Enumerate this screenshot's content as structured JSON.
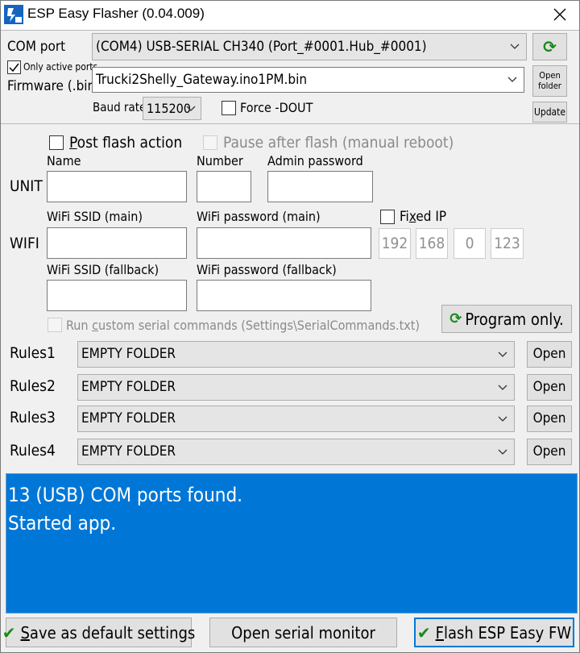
{
  "window": {
    "title": "ESP Easy Flasher (0.04.009)"
  },
  "com": {
    "label": "COM port",
    "value": "(COM4) USB-SERIAL CH340 (Port_#0001.Hub_#0001)",
    "only_active_label": "Only active ports"
  },
  "firmware": {
    "label": "Firmware (.bin)",
    "value": "Trucki2Shelly_Gateway.ino1PM.bin",
    "open_folder_line1": "Open",
    "open_folder_line2": "folder",
    "update_label": "Update"
  },
  "baud": {
    "label": "Baud rate",
    "value": "115200",
    "force_dout_label": "Force -DOUT"
  },
  "post_flash": {
    "label_first": "P",
    "label_rest": "ost flash action",
    "pause_label": "Pause after flash (manual reboot)"
  },
  "unit": {
    "row_label": "UNIT",
    "name_label": "Name",
    "number_label": "Number",
    "admin_label": "Admin password"
  },
  "wifi": {
    "row_label": "WIFI",
    "ssid_main_label": "WiFi SSID (main)",
    "password_main_label": "WiFi password (main)",
    "ssid_fallback_label": "WiFi SSID (fallback)",
    "password_fallback_label": "WiFi password (fallback)",
    "fixed_ip_first": "Fi",
    "fixed_ip_underlined": "x",
    "fixed_ip_rest": "ed IP",
    "ip_octets": [
      "192",
      "168",
      "0",
      "123"
    ]
  },
  "custom_serial": {
    "label_first": "Run ",
    "label_underlined": "c",
    "label_rest": "ustom serial commands (Settings\\SerialCommands.txt)",
    "program_only_label": "Program only."
  },
  "rules": [
    {
      "label": "Rules1",
      "value": "EMPTY FOLDER",
      "open_label": "Open"
    },
    {
      "label": "Rules2",
      "value": "EMPTY FOLDER",
      "open_label": "Open"
    },
    {
      "label": "Rules3",
      "value": "EMPTY FOLDER",
      "open_label": "Open"
    },
    {
      "label": "Rules4",
      "value": "EMPTY FOLDER",
      "open_label": "Open"
    }
  ],
  "log": {
    "lines": [
      "13 (USB) COM ports found.",
      "Started app."
    ]
  },
  "bottom": {
    "save_first": "S",
    "save_rest": "ave as default settings",
    "monitor_label": "Open serial monitor",
    "flash_first": "F",
    "flash_rest": "lash ESP Easy FW"
  },
  "colors": {
    "log_background": "#0077d7",
    "log_text": "#ffffff",
    "check_icon": "#1a8a1a",
    "window_background": "#f0f0f0"
  },
  "icons": {
    "app": "esp-easy-app-icon",
    "close": "close-icon",
    "refresh": "refresh-icon",
    "dropdown": "chevron-down-icon",
    "check": "checkmark-icon"
  }
}
